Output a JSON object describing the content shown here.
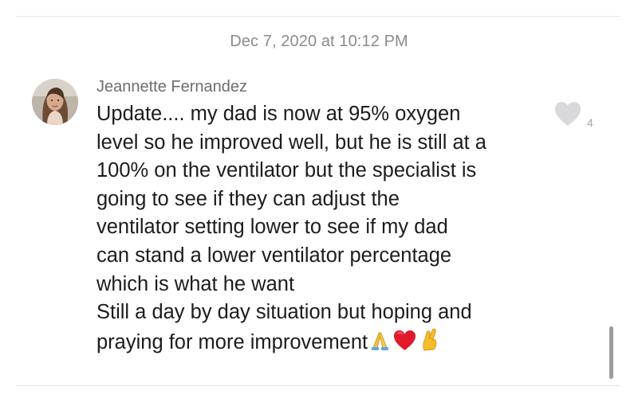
{
  "conversation": {
    "timestamp": "Dec 7, 2020 at 10:12 PM"
  },
  "comment": {
    "author": "Jeannette Fernandez",
    "message_text": "Update.... my dad is now at 95% oxygen\nlevel so he improved well, but he is still at a\n100% on the ventilator but the specialist is\ngoing to see if they can adjust the\nventilator setting lower to see if my dad\ncan stand a lower ventilator percentage\nwhich is what he want\nStill a day by day situation but hoping and\npraying for more improvement",
    "emojis": [
      "folded-hands-emoji",
      "red-heart-emoji",
      "crossed-fingers-emoji"
    ],
    "like_count": "4"
  },
  "icons": {
    "like": "heart-icon",
    "avatar": "profile-photo"
  },
  "colors": {
    "heart": "#d9d9dc",
    "text": "#1c1c1e",
    "meta": "#8a8a8f",
    "emoji_heart": "#e0192b"
  }
}
